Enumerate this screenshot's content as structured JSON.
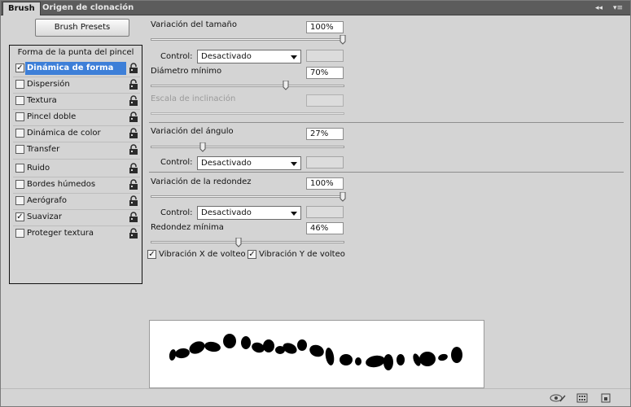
{
  "tabs": [
    {
      "label": "Brush",
      "active": true
    },
    {
      "label": "Origen de clonación",
      "active": false
    }
  ],
  "tab_controls": {
    "collapse": "◂◂",
    "menu": "▾≡"
  },
  "brush_presets_label": "Brush Presets",
  "list": {
    "header": "Forma de la punta del pincel",
    "items": [
      {
        "label": "Dinámica de forma",
        "checked": true,
        "selected": true
      },
      {
        "label": "Dispersión",
        "checked": false
      },
      {
        "label": "Textura",
        "checked": false
      },
      {
        "label": "Pincel doble",
        "checked": false
      },
      {
        "label": "Dinámica de color",
        "checked": false
      },
      {
        "label": "Transfer",
        "checked": false
      },
      {
        "label": "Ruido",
        "checked": false
      },
      {
        "label": "Bordes húmedos",
        "checked": false
      },
      {
        "label": "Aerógrafo",
        "checked": false
      },
      {
        "label": "Suavizar",
        "checked": true
      },
      {
        "label": "Proteger textura",
        "checked": false
      }
    ]
  },
  "settings": {
    "size_jitter": {
      "label": "Variación del tamaño",
      "value": "100%",
      "level": 1.0
    },
    "size_control": {
      "label": "Control:",
      "value": "Desactivado"
    },
    "min_diameter": {
      "label": "Diámetro mínimo",
      "value": "70%",
      "level": 0.7
    },
    "tilt_scale": {
      "label": "Escala de inclinación",
      "value": ""
    },
    "angle_jitter": {
      "label": "Variación del ángulo",
      "value": "27%",
      "level": 0.27
    },
    "angle_control": {
      "label": "Control:",
      "value": "Desactivado"
    },
    "roundness_jitter": {
      "label": "Variación de la redondez",
      "value": "100%",
      "level": 1.0
    },
    "roundness_control": {
      "label": "Control:",
      "value": "Desactivado"
    },
    "min_roundness": {
      "label": "Redondez mínima",
      "value": "46%",
      "level": 0.46
    },
    "flip_x": {
      "label": "Vibración X de volteo",
      "checked": true
    },
    "flip_y": {
      "label": "Vibración Y de volteo",
      "checked": true
    }
  },
  "icons": {
    "lock": "lock-icon",
    "checkmark": "✓",
    "bottom": [
      "eye-brush-icon",
      "grid-icon",
      "new-preset-icon"
    ]
  },
  "colors": {
    "selection": "#3d7fd8",
    "panel": "#d4d4d4",
    "tabbar": "#5c5c5c"
  }
}
